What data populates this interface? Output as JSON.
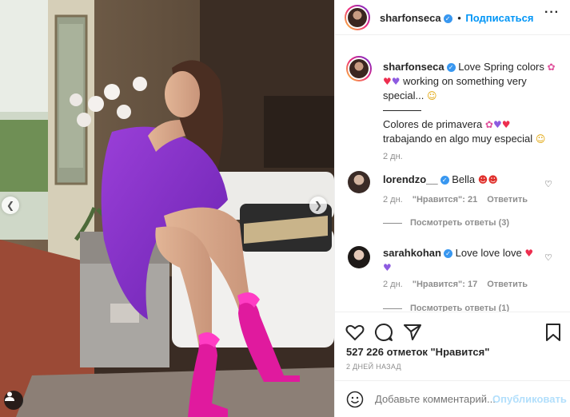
{
  "header": {
    "username": "sharfonseca",
    "follow_label": "Подписаться",
    "dot": "•"
  },
  "caption": {
    "username": "sharfonseca",
    "line1_text": "Love Spring colors",
    "line2_text": "working on something very",
    "line3_text": "special...",
    "line4_text": "Colores de primavera",
    "line5_text": "trabajando en algo muy especial",
    "time": "2 дн."
  },
  "comments": [
    {
      "username": "lorendzo__",
      "text": "Bella",
      "time": "2 дн.",
      "likes": "\"Нравится\": 21",
      "reply": "Ответить",
      "view_replies": "Посмотреть ответы (3)"
    },
    {
      "username": "sarahkohan",
      "text": "Love love love",
      "time": "2 дн.",
      "likes": "\"Нравится\": 17",
      "reply": "Ответить",
      "view_replies": "Посмотреть ответы (1)"
    }
  ],
  "actions": {
    "likes_text": "527 226 отметок \"Нравится\"",
    "posted_ago": "2 ДНЕЙ НАЗАД"
  },
  "add_comment": {
    "placeholder": "Добавьте комментарий...",
    "post_label": "Опубликовать"
  },
  "colors": {
    "link": "#0095f6",
    "muted": "#8e8e8e",
    "text": "#262626",
    "verified": "#3897f0"
  },
  "icons": [
    "chevron-left-icon",
    "chevron-right-icon",
    "user-tag-icon",
    "verified-icon",
    "more-icon",
    "heart-icon",
    "comment-icon",
    "share-icon",
    "bookmark-icon",
    "emoji-icon"
  ]
}
